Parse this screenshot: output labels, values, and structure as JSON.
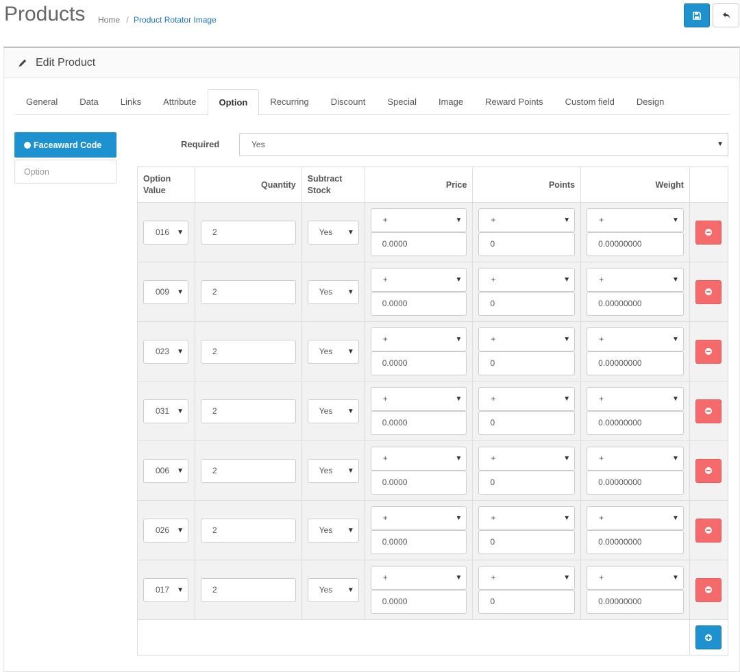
{
  "header": {
    "title": "Products",
    "breadcrumb": [
      {
        "label": "Home"
      },
      {
        "label": "Product Rotator Image"
      }
    ],
    "save_icon": "save-icon",
    "back_icon": "reply-icon"
  },
  "panel": {
    "title": "Edit Product",
    "title_icon": "pencil-icon"
  },
  "tabs": [
    "General",
    "Data",
    "Links",
    "Attribute",
    "Option",
    "Recurring",
    "Discount",
    "Special",
    "Image",
    "Reward Points",
    "Custom field",
    "Design"
  ],
  "active_tab": "Option",
  "options_nav": {
    "active": "Faceaward Code",
    "input_placeholder": "Option"
  },
  "required": {
    "label": "Required",
    "value": "Yes"
  },
  "table": {
    "headers": {
      "option_value_1": "Option",
      "option_value_2": "Value",
      "quantity": "Quantity",
      "subtract_1": "Subtract",
      "subtract_2": "Stock",
      "price": "Price",
      "points": "Points",
      "weight": "Weight"
    },
    "rows": [
      {
        "option_value": "016",
        "quantity": "2",
        "subtract": "Yes",
        "price_prefix": "+",
        "price": "0.0000",
        "points_prefix": "+",
        "points": "0",
        "weight_prefix": "+",
        "weight": "0.00000000"
      },
      {
        "option_value": "009",
        "quantity": "2",
        "subtract": "Yes",
        "price_prefix": "+",
        "price": "0.0000",
        "points_prefix": "+",
        "points": "0",
        "weight_prefix": "+",
        "weight": "0.00000000"
      },
      {
        "option_value": "023",
        "quantity": "2",
        "subtract": "Yes",
        "price_prefix": "+",
        "price": "0.0000",
        "points_prefix": "+",
        "points": "0",
        "weight_prefix": "+",
        "weight": "0.00000000"
      },
      {
        "option_value": "031",
        "quantity": "2",
        "subtract": "Yes",
        "price_prefix": "+",
        "price": "0.0000",
        "points_prefix": "+",
        "points": "0",
        "weight_prefix": "+",
        "weight": "0.00000000"
      },
      {
        "option_value": "006",
        "quantity": "2",
        "subtract": "Yes",
        "price_prefix": "+",
        "price": "0.0000",
        "points_prefix": "+",
        "points": "0",
        "weight_prefix": "+",
        "weight": "0.00000000"
      },
      {
        "option_value": "026",
        "quantity": "2",
        "subtract": "Yes",
        "price_prefix": "+",
        "price": "0.0000",
        "points_prefix": "+",
        "points": "0",
        "weight_prefix": "+",
        "weight": "0.00000000"
      },
      {
        "option_value": "017",
        "quantity": "2",
        "subtract": "Yes",
        "price_prefix": "+",
        "price": "0.0000",
        "points_prefix": "+",
        "points": "0",
        "weight_prefix": "+",
        "weight": "0.00000000"
      }
    ]
  },
  "colors": {
    "primary": "#1e91cf",
    "danger": "#f56b6b",
    "link": "#1e77c0"
  }
}
